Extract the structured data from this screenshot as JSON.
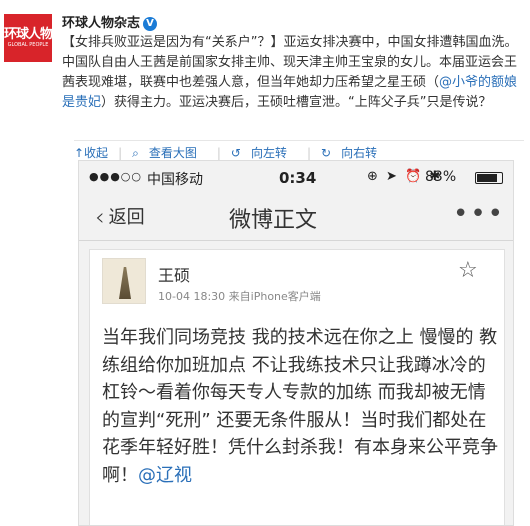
{
  "post": {
    "avatar_text": "环球人物",
    "avatar_subtext": "GLOBAL PEOPLE",
    "author": "环球人物杂志",
    "verified_mark": "V",
    "text_main": "【女排兵败亚运是因为有“关系户”？】亚运女排决赛中，中国女排遭韩国血洗。中国队自由人王茜是前国家女排主帅、现天津主帅王宝泉的女儿。本届亚运会王茜表现难堪，联赛中也差强人意，但当年她却力压希望之星王硕（",
    "text_link": "@小爷的额娘是贵妃",
    "text_tail": "）获得主力。亚运决赛后，王硕吐槽宣泄。“上阵父子兵”只是传说？"
  },
  "actions": {
    "collapse": "↑收起",
    "view_large": "查看大图",
    "rotate_left": "向左转",
    "rotate_right": "向右转"
  },
  "screenshot": {
    "status": {
      "signal": "●●●○○",
      "carrier": "中国移动",
      "time": "0:34",
      "icons": "⊕ ➤ ⏰ ✱",
      "battery": "83%",
      "battery_level": 0.83
    },
    "nav": {
      "back_label": "返回",
      "title": "微博正文",
      "more": "•••"
    },
    "weibo": {
      "name": "王硕",
      "meta": "10-04 18:30  来自iPhone客户端",
      "body": "当年我们同场竞技 我的技术远在你之上 慢慢的 教练组给你加班加点 不让我练技术只让我蹲冰冷的杠铃～看着你每天专人专款的加练 而我却被无情的宣判“死刑” 还要无条件服从！当时我们都处在花季年轻好胜！凭什么封杀我！有本身来公平竞争啊！",
      "mention": "@辽视"
    }
  }
}
